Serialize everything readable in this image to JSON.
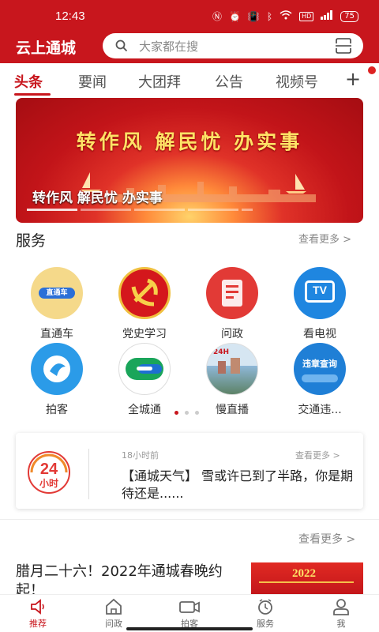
{
  "status_bar": {
    "time": "12:43",
    "battery": "75",
    "hd": "HD"
  },
  "header": {
    "title": "云上通城",
    "search_placeholder": "大家都在搜"
  },
  "tabs": [
    {
      "label": "头条",
      "active": true
    },
    {
      "label": "要闻"
    },
    {
      "label": "大团拜"
    },
    {
      "label": "公告"
    },
    {
      "label": "视频号"
    }
  ],
  "tab_add": "+",
  "banner": {
    "slogan": "转作风  解民忧  办实事",
    "caption": "转作风 解民忧 办实事"
  },
  "services": {
    "title": "服务",
    "more": "查看更多 >",
    "items": [
      {
        "label": "直通车",
        "icon": "bus-badge-icon"
      },
      {
        "label": "党史学习",
        "icon": "party-emblem-icon"
      },
      {
        "label": "问政",
        "icon": "inquiry-icon"
      },
      {
        "label": "看电视",
        "icon": "tv-icon"
      },
      {
        "label": "拍客",
        "icon": "camera-bird-icon"
      },
      {
        "label": "全城通",
        "icon": "city-pass-icon"
      },
      {
        "label": "慢直播",
        "icon": "live-stream-icon"
      },
      {
        "label": "交通违...",
        "icon": "traffic-violation-icon"
      }
    ],
    "icon_texts": {
      "bus": "直通车",
      "tv": "TV",
      "live": "24H",
      "traffic": "违章查询"
    }
  },
  "weather_card": {
    "logo_number": "24",
    "logo_unit": "小时",
    "time": "18小时前",
    "more": "查看更多 >",
    "text": "【通城天气】 雪或许已到了半路，你是期待还是......"
  },
  "news": {
    "more": "查看更多 >",
    "title": "腊月二十六！2022年通城春晚约起！",
    "thumb_text": "2022"
  },
  "bottom_nav": [
    {
      "label": "推荐",
      "icon": "speaker-icon",
      "active": true
    },
    {
      "label": "问政",
      "icon": "house-icon"
    },
    {
      "label": "拍客",
      "icon": "video-camera-icon"
    },
    {
      "label": "服务",
      "icon": "clock-icon"
    },
    {
      "label": "我",
      "icon": "person-icon"
    }
  ],
  "colors": {
    "brand_red": "#c8161d",
    "banner_yellow": "#ffe266"
  }
}
